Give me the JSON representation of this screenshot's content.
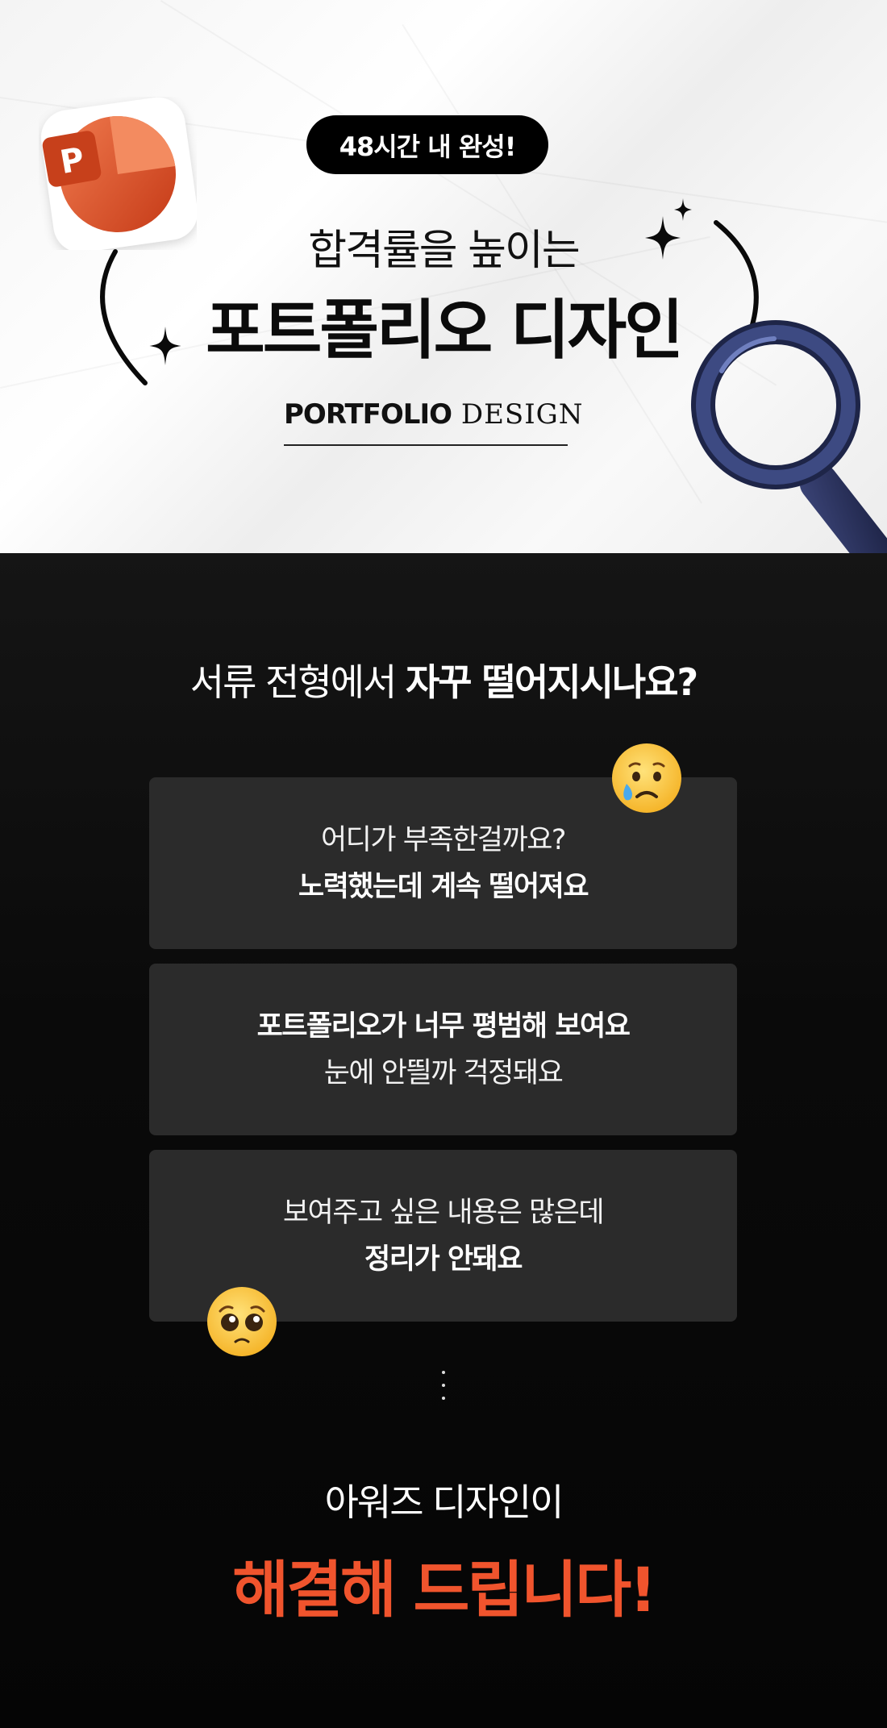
{
  "hero": {
    "badge": "48시간 내 완성!",
    "subtitle": "합격률을 높이는",
    "title": "포트폴리오 디자인",
    "english_bold": "PORTFOLIO",
    "english_light": " DESIGN",
    "ppt_icon_letter": "P"
  },
  "problems": {
    "question_light": "서류 전형에서 ",
    "question_bold": "자꾸 떨어지시나요?",
    "cards": [
      {
        "line1": "어디가 부족한걸까요?",
        "line2": "노력했는데 계속 떨어져요"
      },
      {
        "line1": "포트폴리오가 너무 평범해 보여요",
        "line2": "눈에 안띌까 걱정돼요"
      },
      {
        "line1": "보여주고 싶은 내용은 많은데",
        "line2": "정리가 안돼요"
      }
    ]
  },
  "solution": {
    "line1": "아워즈 디자인이",
    "line2": "해결해 드립니다!"
  },
  "colors": {
    "accent": "#f0542d",
    "card_bg": "#2b2b2b",
    "ppt_orange": "#e24e2a",
    "magnifier_navy": "#2f3a6b"
  },
  "icons": [
    "powerpoint-icon",
    "magnifier-icon",
    "sparkle-icon",
    "crying-face-emoji",
    "pleading-face-emoji"
  ]
}
